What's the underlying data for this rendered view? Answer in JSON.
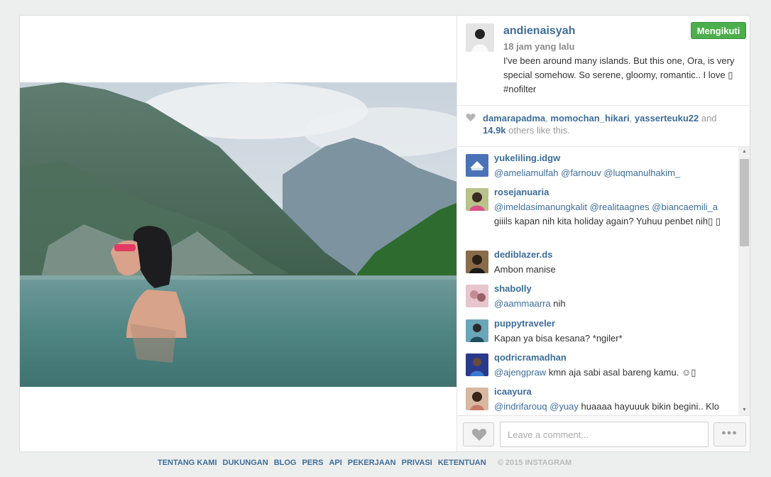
{
  "post": {
    "username": "andienaisyah",
    "time_ago": "18 jam yang lalu",
    "caption": "I've been around many islands. But this one, Ora, is very special somehow. So serene, gloomy, romantic.. I love ▯ #nofilter",
    "follow_label": "Mengikuti"
  },
  "likes": {
    "user1": "damarapadma",
    "sep1": ", ",
    "user2": "momochan_hikari",
    "sep2": ", ",
    "user3": "yasserteuku22",
    "and": " and ",
    "count": "14.9k",
    "suffix": " others like this."
  },
  "comments": [
    {
      "user": "yukeliling.idgw",
      "mentions": [
        "@ameliamulfah",
        "@farnouv",
        "@luqmanulhakim_"
      ],
      "text": ""
    },
    {
      "user": "rosejanuaria",
      "mentions": [
        "@imeldasimanungkalit",
        "@realitaagnes",
        "@biancaemili_a"
      ],
      "text": "giiils kapan nih kita holiday again? Yuhuu penbet nih▯ ▯"
    },
    {
      "user": "dediblazer.ds",
      "mentions": [],
      "text": "Ambon manise"
    },
    {
      "user": "shabolly",
      "mentions": [
        "@aammaarra"
      ],
      "text": "nih"
    },
    {
      "user": "puppytraveler",
      "mentions": [],
      "text": "Kapan ya bisa kesana? *ngiler*"
    },
    {
      "user": "qodricramadhan",
      "mentions": [
        "@ajengpraw"
      ],
      "text": "kmn aja sabi asal bareng kamu. ☺▯"
    },
    {
      "user": "icaayura",
      "mentions": [
        "@indrifarouq",
        "@yuay"
      ],
      "text": "huaaaa hayuuuk bikin begini.. Klo"
    }
  ],
  "comment_box": {
    "placeholder": "Leave a comment...",
    "more_label": "•••"
  },
  "footer": {
    "links": [
      "TENTANG KAMI",
      "DUKUNGAN",
      "BLOG",
      "PERS",
      "API",
      "PEKERJAAN",
      "PRIVASI",
      "KETENTUAN"
    ],
    "copyright": "© 2015 INSTAGRAM"
  },
  "colors": {
    "link": "#3d6d99",
    "follow_button": "#4cae4c",
    "background": "#edeeee"
  },
  "icons": {
    "like": "heart-icon",
    "more": "more-options-icon"
  }
}
